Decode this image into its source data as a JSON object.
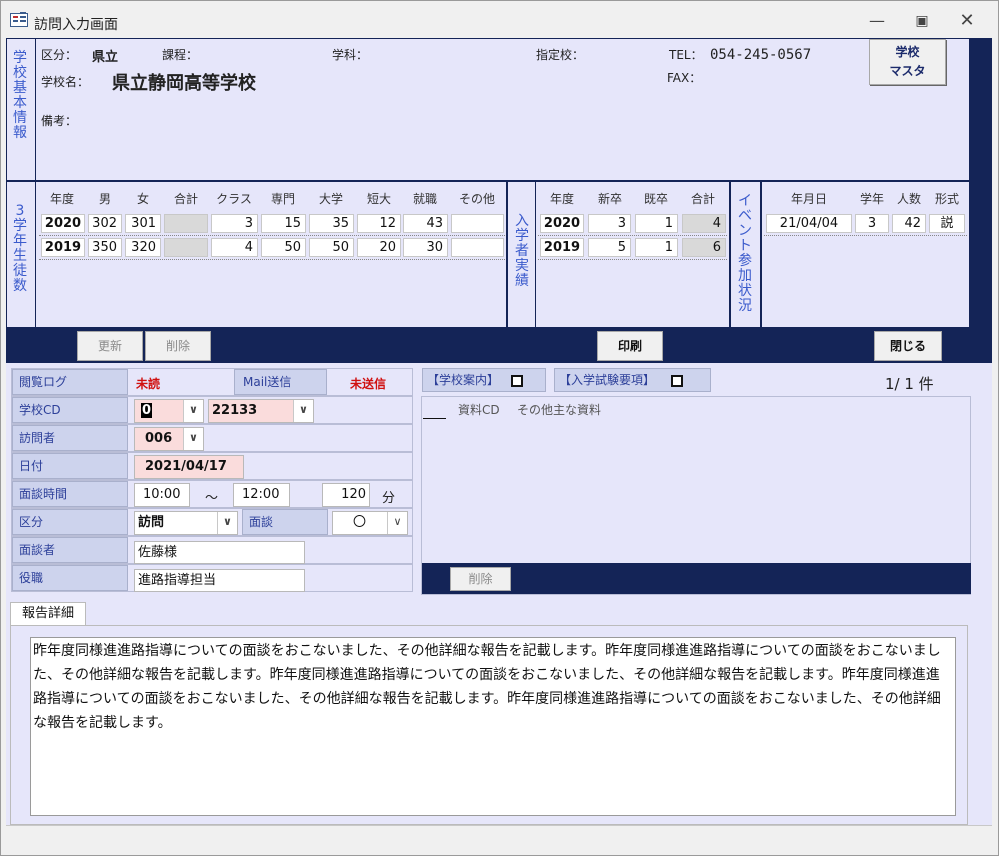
{
  "window": {
    "title": "訪問入力画面",
    "min_icon": "minimize-icon",
    "max_icon": "maximize-icon",
    "close_icon": "close-icon"
  },
  "school_info": {
    "section_label": "学校基本情報",
    "kubun_label": "区分：",
    "kubun_value": "県立",
    "katei_label": "課程：",
    "gakka_label": "学科：",
    "shitei_label": "指定校：",
    "tel_label": "TEL：",
    "tel_value": "054-245-0567",
    "fax_label": "FAX：",
    "school_name_label": "学校名：",
    "school_name": "県立静岡高等学校",
    "bikou_label": "備考：",
    "master_button_line1": "学校",
    "master_button_line2": "マスタ"
  },
  "students": {
    "section_label": "3学年生徒数",
    "headers": [
      "年度",
      "男",
      "女",
      "合計",
      "クラス",
      "専門",
      "大学",
      "短大",
      "就職",
      "その他"
    ],
    "rows": [
      {
        "year": "2020",
        "male": "302",
        "female": "301",
        "total": "",
        "classes": "3",
        "senmon": "15",
        "daigaku": "35",
        "tandai": "12",
        "shushoku": "43",
        "other": ""
      },
      {
        "year": "2019",
        "male": "350",
        "female": "320",
        "total": "",
        "classes": "4",
        "senmon": "50",
        "daigaku": "50",
        "tandai": "20",
        "shushoku": "30",
        "other": ""
      }
    ]
  },
  "admission": {
    "section_label": "入学者実績",
    "headers": [
      "年度",
      "新卒",
      "既卒",
      "合計"
    ],
    "rows": [
      {
        "year": "2020",
        "new": "3",
        "old": "1",
        "total": "4"
      },
      {
        "year": "2019",
        "new": "5",
        "old": "1",
        "total": "6"
      }
    ]
  },
  "events": {
    "section_label": "イベント参加状況",
    "headers": [
      "年月日",
      "学年",
      "人数",
      "形式"
    ],
    "rows": [
      {
        "date": "21/04/04",
        "grade": "3",
        "count": "42",
        "type": "説"
      }
    ]
  },
  "toolbar": {
    "update": "更新",
    "delete": "削除",
    "print": "印刷",
    "close": "閉じる"
  },
  "form": {
    "log_label": "閲覧ログ",
    "log_value": "未読",
    "mail_label": "Mail送信",
    "mail_value": "未送信",
    "school_cd_label": "学校CD",
    "school_cd_prefix": "0",
    "school_cd_value": "22133",
    "visitor_label": "訪問者",
    "visitor_value": "006",
    "date_label": "日付",
    "date_value": "2021/04/17",
    "time_label": "面談時間",
    "time_from": "10:00",
    "time_sep": "～",
    "time_to": "12:00",
    "minutes": "120",
    "minutes_unit": "分",
    "kubun_label": "区分",
    "kubun_value": "訪問",
    "mendan_label": "面談",
    "mendan_value": "〇",
    "person_label": "面談者",
    "person_value": "佐藤様",
    "role_label": "役職",
    "role_value": "進路指導担当"
  },
  "materials": {
    "guide_label": "【学校案内】",
    "exam_label": "【入学試験要項】",
    "count": "1/ 1 件",
    "col_cd": "資料CD",
    "col_other": "その他主な資料",
    "delete": "削除"
  },
  "report": {
    "tab_label": "報告詳細",
    "text": "昨年度同様進進路指導についての面談をおこないました、その他詳細な報告を記載します。昨年度同様進進路指導についての面談をおこないました、その他詳細な報告を記載します。昨年度同様進進路指導についての面談をおこないました、その他詳細な報告を記載します。昨年度同様進進路指導についての面談をおこないました、その他詳細な報告を記載します。昨年度同様進進路指導についての面談をおこないました、その他詳細な報告を記載します。"
  }
}
